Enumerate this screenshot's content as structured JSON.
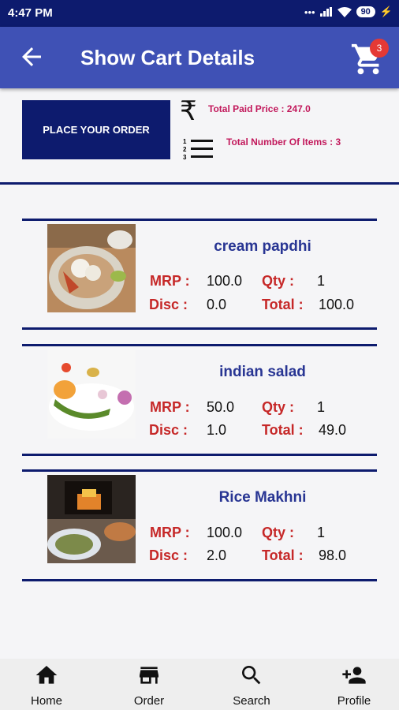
{
  "status": {
    "time": "4:47 PM",
    "battery": "90"
  },
  "appbar": {
    "title": "Show Cart Details",
    "cart_count": "3"
  },
  "summary": {
    "place_order_label": "PLACE YOUR ORDER",
    "rupee_symbol": "₹",
    "total_paid": "Total Paid Price : 247.0",
    "total_items": "Total Number Of Items : 3"
  },
  "labels": {
    "mrp": "MRP :",
    "qty": "Qty :",
    "disc": "Disc :",
    "total": "Total :"
  },
  "items": [
    {
      "name": "cream papdhi",
      "mrp": "100.0",
      "qty": "1",
      "disc": "0.0",
      "total": "100.0"
    },
    {
      "name": "indian salad",
      "mrp": "50.0",
      "qty": "1",
      "disc": "1.0",
      "total": "49.0"
    },
    {
      "name": "Rice Makhni",
      "mrp": "100.0",
      "qty": "1",
      "disc": "2.0",
      "total": "98.0"
    }
  ],
  "nav": [
    {
      "label": "Home",
      "icon": "home-icon"
    },
    {
      "label": "Order",
      "icon": "store-icon"
    },
    {
      "label": "Search",
      "icon": "search-icon"
    },
    {
      "label": "Profile",
      "icon": "add-person-icon"
    }
  ]
}
